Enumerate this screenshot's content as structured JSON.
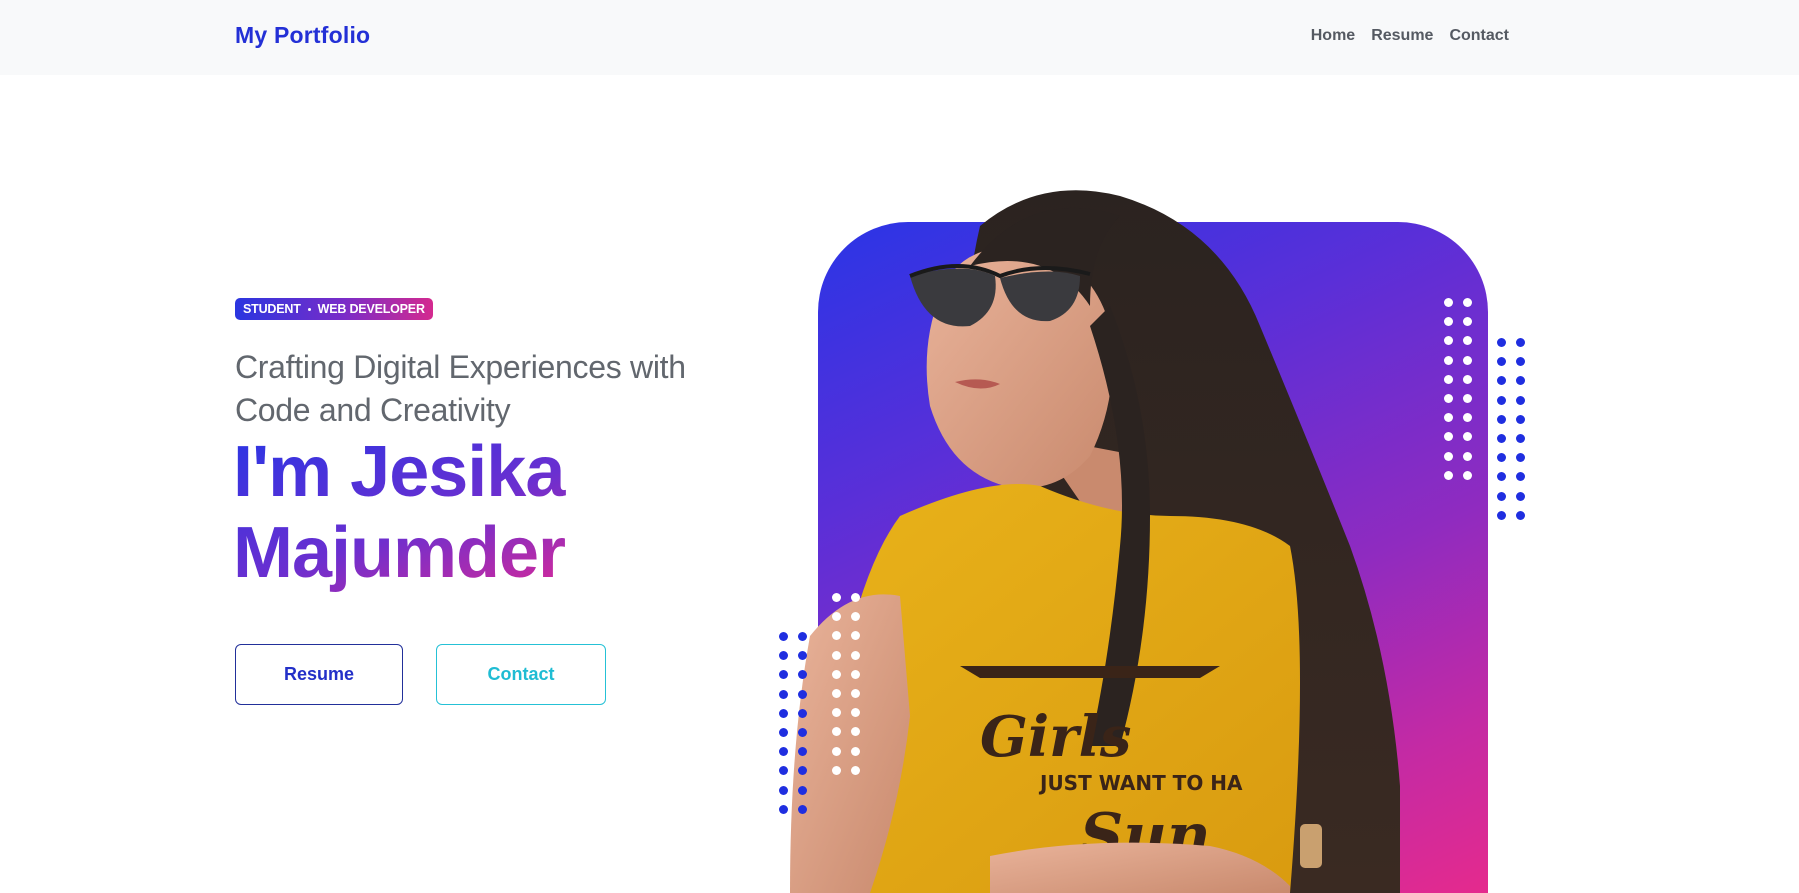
{
  "navbar": {
    "brand": "My Portfolio",
    "links": [
      {
        "label": "Home"
      },
      {
        "label": "Resume"
      },
      {
        "label": "Contact"
      }
    ]
  },
  "hero": {
    "badge": {
      "left": "STUDENT",
      "right": "WEB DEVELOPER"
    },
    "tagline": "Crafting Digital Experiences with Code and Creativity",
    "name_line1": "I'm Jesika",
    "name_line2": "Majumder",
    "buttons": {
      "resume": "Resume",
      "contact": "Contact"
    },
    "portrait_alt": "Portrait of Jesika Majumder wearing sunglasses and a yellow t-shirt"
  },
  "colors": {
    "brand_blue": "#2330d6",
    "accent_pink": "#e02a86",
    "contact_cyan": "#1fbcd3",
    "dot_blue": "#1f2ee0",
    "dot_white": "#ffffff"
  }
}
